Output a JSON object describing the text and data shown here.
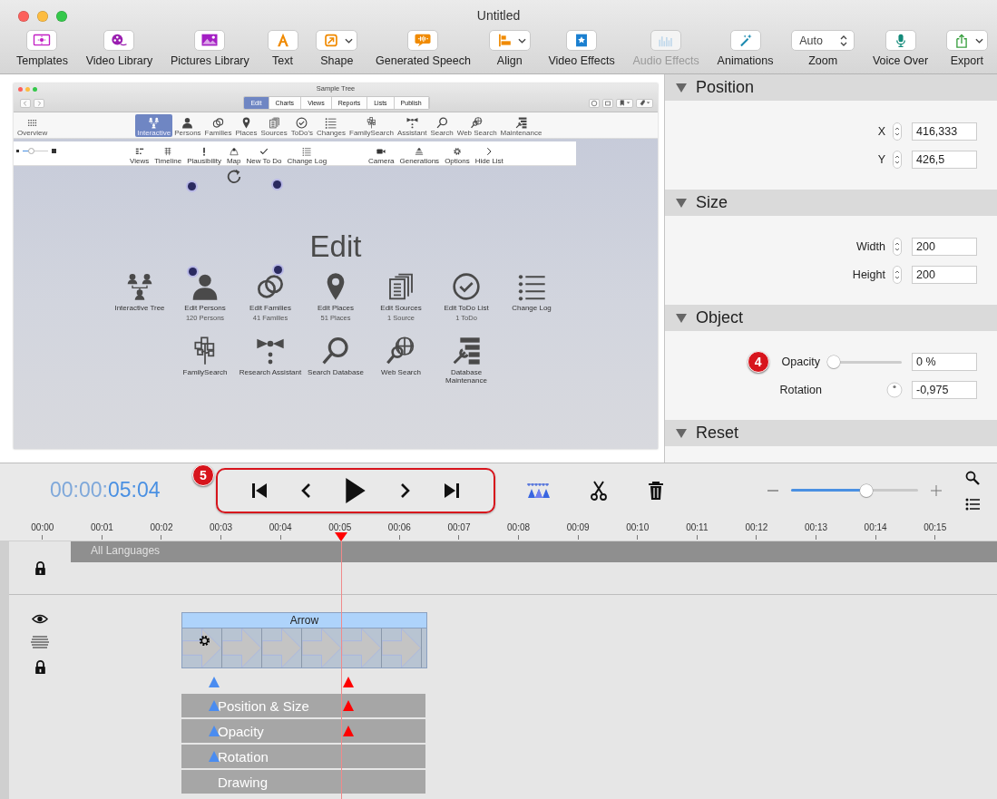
{
  "window": {
    "title": "Untitled"
  },
  "toolbar": [
    {
      "label": "Templates",
      "kind": "button",
      "disabled": false
    },
    {
      "label": "Video Library",
      "kind": "button",
      "disabled": false
    },
    {
      "label": "Pictures Library",
      "kind": "button",
      "disabled": false
    },
    {
      "label": "Text",
      "kind": "button",
      "disabled": false
    },
    {
      "label": "Shape",
      "kind": "menu",
      "disabled": false
    },
    {
      "label": "Generated Speech",
      "kind": "button",
      "disabled": false
    },
    {
      "label": "Align",
      "kind": "menu",
      "disabled": false
    },
    {
      "label": "Video Effects",
      "kind": "button",
      "disabled": false
    },
    {
      "label": "Audio Effects",
      "kind": "button",
      "disabled": true
    },
    {
      "label": "Animations",
      "kind": "button",
      "disabled": false
    },
    {
      "label": "Zoom",
      "kind": "stepper",
      "value": "Auto",
      "disabled": false
    },
    {
      "label": "Voice Over",
      "kind": "button",
      "disabled": false
    },
    {
      "label": "Export",
      "kind": "menu",
      "disabled": false
    }
  ],
  "preview": {
    "title": "Sample Tree",
    "tabs": [
      {
        "label": "Edit",
        "selected": true
      },
      {
        "label": "Charts",
        "selected": false
      },
      {
        "label": "Views",
        "selected": false
      },
      {
        "label": "Reports",
        "selected": false
      },
      {
        "label": "Lists",
        "selected": false
      },
      {
        "label": "Publish",
        "selected": false
      }
    ],
    "modules": [
      {
        "label": "Overview",
        "selected": false
      },
      {
        "label": "Interactive",
        "selected": true
      },
      {
        "label": "Persons",
        "selected": false
      },
      {
        "label": "Families",
        "selected": false
      },
      {
        "label": "Places",
        "selected": false
      },
      {
        "label": "Sources",
        "selected": false
      },
      {
        "label": "ToDo's",
        "selected": false
      },
      {
        "label": "Changes",
        "selected": false
      },
      {
        "label": "FamilySearch",
        "selected": false
      },
      {
        "label": "Assistant",
        "selected": false
      },
      {
        "label": "Search",
        "selected": false
      },
      {
        "label": "Web Search",
        "selected": false
      },
      {
        "label": "Maintenance",
        "selected": false
      }
    ],
    "size_slider": {
      "level": 0.35
    },
    "tools": [
      "Views",
      "Timeline",
      "Plausibility",
      "Map",
      "New To Do",
      "Change Log"
    ],
    "view_tools": [
      "Camera",
      "Generations",
      "Options",
      "Hide List"
    ],
    "heading": "Edit",
    "tiles": [
      [
        {
          "label": "Interactive Tree"
        },
        {
          "label": "Edit Persons",
          "sub": "120 Persons"
        },
        {
          "label": "Edit Families",
          "sub": "41 Families"
        },
        {
          "label": "Edit Places",
          "sub": "51 Places"
        },
        {
          "label": "Edit Sources",
          "sub": "1 Source"
        },
        {
          "label": "Edit ToDo List",
          "sub": "1 ToDo"
        },
        {
          "label": "Change Log"
        }
      ],
      [
        {
          "label": "FamilySearch"
        },
        {
          "label": "Research Assistant"
        },
        {
          "label": "Search Database"
        },
        {
          "label": "Web Search"
        },
        {
          "label": "Database Maintenance"
        }
      ]
    ]
  },
  "inspector": [
    {
      "title": "Position",
      "expanded": true,
      "fields": [
        {
          "kind": "number",
          "label": "X",
          "value": "416,333"
        },
        {
          "kind": "number",
          "label": "Y",
          "value": "426,5"
        }
      ]
    },
    {
      "title": "Size",
      "expanded": true,
      "fields": [
        {
          "kind": "number",
          "label": "Width",
          "value": "200"
        },
        {
          "kind": "number",
          "label": "Height",
          "value": "200"
        }
      ]
    },
    {
      "title": "Object",
      "expanded": true,
      "fields": [
        {
          "kind": "slider",
          "label": "Opacity",
          "level": 0,
          "value": "0 %",
          "callout": "4"
        },
        {
          "kind": "dial",
          "label": "Rotation",
          "value": "-0,975"
        }
      ]
    },
    {
      "title": "Reset",
      "expanded": true
    }
  ],
  "timeline": {
    "time_elapsed": "00:00:",
    "time": "05:04",
    "callout": "5",
    "zoom": {
      "level": 0.59
    },
    "ruler": [
      "00:00",
      "00:01",
      "00:02",
      "00:03",
      "00:04",
      "00:05",
      "00:06",
      "00:07",
      "00:08",
      "00:09",
      "00:10",
      "00:11",
      "00:12",
      "00:13",
      "00:14",
      "00:15"
    ],
    "audio_track": {
      "label": "All Languages"
    },
    "object_track": {
      "clip": "Arrow",
      "keyframes": [
        {
          "color": "#4a8cf0"
        },
        {
          "color": "#ff0000"
        }
      ],
      "properties": [
        {
          "label": "Position & Size",
          "keyframes": [
            {
              "color": "#4a8cf0"
            },
            {
              "color": "#ff0000"
            }
          ]
        },
        {
          "label": "Opacity",
          "keyframes": [
            {
              "color": "#4a8cf0"
            },
            {
              "color": "#ff0000"
            }
          ]
        },
        {
          "label": "Rotation",
          "keyframes": [
            {
              "color": "#4a8cf0"
            }
          ]
        },
        {
          "label": "Drawing"
        }
      ]
    }
  }
}
